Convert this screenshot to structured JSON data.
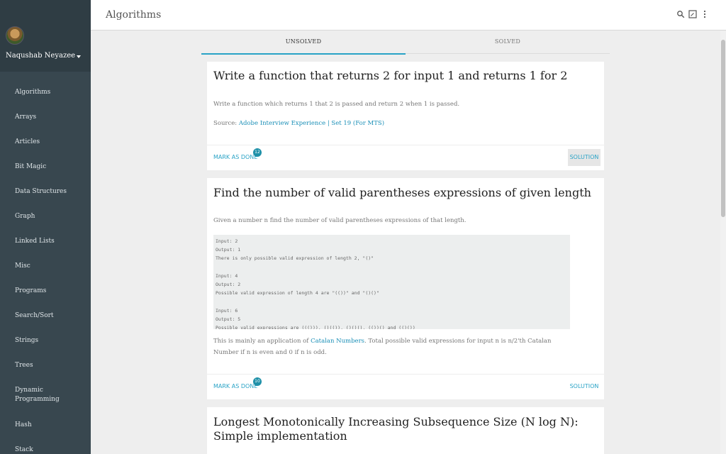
{
  "user": {
    "name": "Naqushab Neyazee"
  },
  "sidebar": {
    "items": [
      {
        "label": "Algorithms"
      },
      {
        "label": "Arrays"
      },
      {
        "label": "Articles"
      },
      {
        "label": "Bit Magic"
      },
      {
        "label": "Data Structures"
      },
      {
        "label": "Graph"
      },
      {
        "label": "Linked Lists"
      },
      {
        "label": "Misc"
      },
      {
        "label": "Programs"
      },
      {
        "label": "Search/Sort"
      },
      {
        "label": "Strings"
      },
      {
        "label": "Trees"
      },
      {
        "label": "Dynamic Programming"
      },
      {
        "label": "Hash"
      },
      {
        "label": "Stack"
      }
    ]
  },
  "topbar": {
    "title": "Algorithms",
    "icons": [
      "search-icon",
      "fullscreen-icon",
      "more-vert-icon"
    ]
  },
  "tabs": [
    {
      "label": "UNSOLVED",
      "active": true
    },
    {
      "label": "SOLVED",
      "active": false
    }
  ],
  "cards": [
    {
      "title": "Write a function that returns 2 for input 1 and returns 1 for 2",
      "description": "Write a function which returns 1 that 2 is passed and return 2 when 1 is passed.",
      "source_label": "Source:",
      "source_link": "Adobe Interview Experience | Set 19 (For MTS)",
      "mark_label": "MARK AS DONE",
      "count": "12",
      "solution_label": "SOLUTION"
    },
    {
      "title": "Find the number of valid parentheses expressions of given length",
      "description": "Given a number n find the number of valid parentheses expressions of that length.",
      "code": "Input: 2\nOutput: 1\nThere is only possible valid expression of length 2, \"()\"\n\nInput: 4\nOutput: 2\nPossible valid expression of length 4 are \"(())\" and \"()()\"\n\nInput: 6\nOutput: 5\nPossible valid expressions are ((())), ()(()), ()()(), (())() and (()())",
      "note_pre": "This is mainly an application of ",
      "note_link": "Catalan Numbers",
      "note_post": ". Total possible valid expressions for input n is n/2'th Catalan Number if n is even and 0 if n is odd.",
      "mark_label": "MARK AS DONE",
      "count": "10",
      "solution_label": "SOLUTION"
    },
    {
      "title": "Longest Monotonically Increasing Subsequence Size (N log N): Simple implementation"
    }
  ]
}
